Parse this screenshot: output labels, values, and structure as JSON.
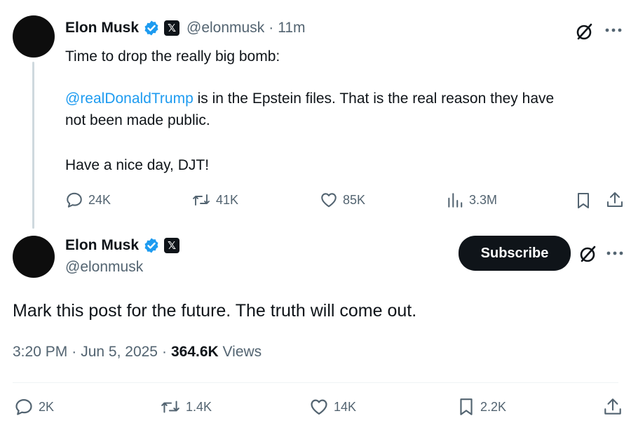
{
  "first_post": {
    "author": {
      "name": "Elon Musk",
      "handle": "@elonmusk",
      "time": "11m",
      "separator": "·"
    },
    "line1": "Time to drop the really big bomb:",
    "mention": "@realDonaldTrump",
    "line2_rest": " is in the Epstein files. That is the real reason they have",
    "line3": "not been made public.",
    "line4": "Have a nice day, DJT!",
    "stats": {
      "replies": "24K",
      "reposts": "41K",
      "likes": "85K",
      "views": "3.3M"
    }
  },
  "second_post": {
    "author": {
      "name": "Elon Musk",
      "handle": "@elonmusk"
    },
    "subscribe_label": "Subscribe",
    "text": "Mark this post for the future. The truth will come out.",
    "time": "3:20 PM",
    "date": "Jun 5, 2025",
    "views_count": "364.6K",
    "views_label": " Views",
    "separator": "·",
    "stats": {
      "replies": "2K",
      "reposts": "1.4K",
      "likes": "14K",
      "bookmarks": "2.2K"
    }
  },
  "icons": {
    "verified": "verified-badge-icon",
    "x_badge": "x-logo-icon",
    "grok": "grok-icon",
    "more": "more-icon",
    "reply": "reply-icon",
    "repost": "repost-icon",
    "like": "heart-icon",
    "views": "views-icon",
    "bookmark": "bookmark-icon",
    "share": "share-icon"
  },
  "colors": {
    "accent": "#1d9bf0",
    "text": "#0f1419",
    "muted": "#536471",
    "button": "#0f1419"
  }
}
